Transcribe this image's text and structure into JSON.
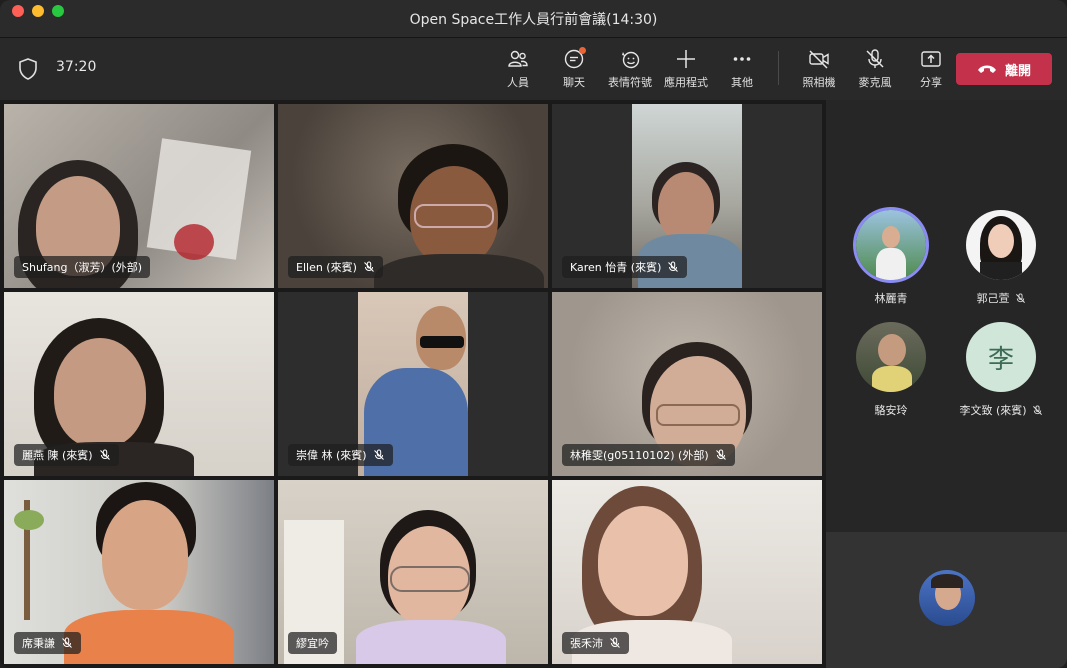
{
  "window": {
    "title": "Open Space工作人員行前會議(14:30)"
  },
  "toolbar": {
    "timer": "37:20",
    "items": [
      {
        "label": "人員",
        "icon": "people-icon"
      },
      {
        "label": "聊天",
        "icon": "chat-icon"
      },
      {
        "label": "表情符號",
        "icon": "emoji-icon"
      },
      {
        "label": "應用程式",
        "icon": "plus-icon"
      },
      {
        "label": "其他",
        "icon": "more-icon"
      }
    ],
    "media": [
      {
        "label": "照相機",
        "icon": "camera-off-icon"
      },
      {
        "label": "麥克風",
        "icon": "mic-off-icon"
      },
      {
        "label": "分享",
        "icon": "share-icon"
      }
    ],
    "leave_label": "離開",
    "accent": "#c4314b"
  },
  "tiles": [
    {
      "name": "Shufang（淑芳）(外部)",
      "muted": false
    },
    {
      "name": "Ellen (來賓)",
      "muted": true
    },
    {
      "name": "Karen 怡青 (來賓)",
      "muted": true
    },
    {
      "name": "麗燕 陳 (來賓)",
      "muted": true
    },
    {
      "name": "崇偉 林 (來賓)",
      "muted": true
    },
    {
      "name": "林稚雯(g05110102) (外部)",
      "muted": true
    },
    {
      "name": "席秉謙",
      "muted": true
    },
    {
      "name": "繆宜吟",
      "muted": false
    },
    {
      "name": "張禾沛",
      "muted": true
    }
  ],
  "panel": {
    "participants": [
      {
        "name": "林麗青",
        "muted": false
      },
      {
        "name": "郭己萱",
        "muted": true
      },
      {
        "name": "駱安玲",
        "muted": false
      },
      {
        "name": "李文致 (來賓)",
        "muted": true,
        "initial": "李"
      }
    ]
  }
}
